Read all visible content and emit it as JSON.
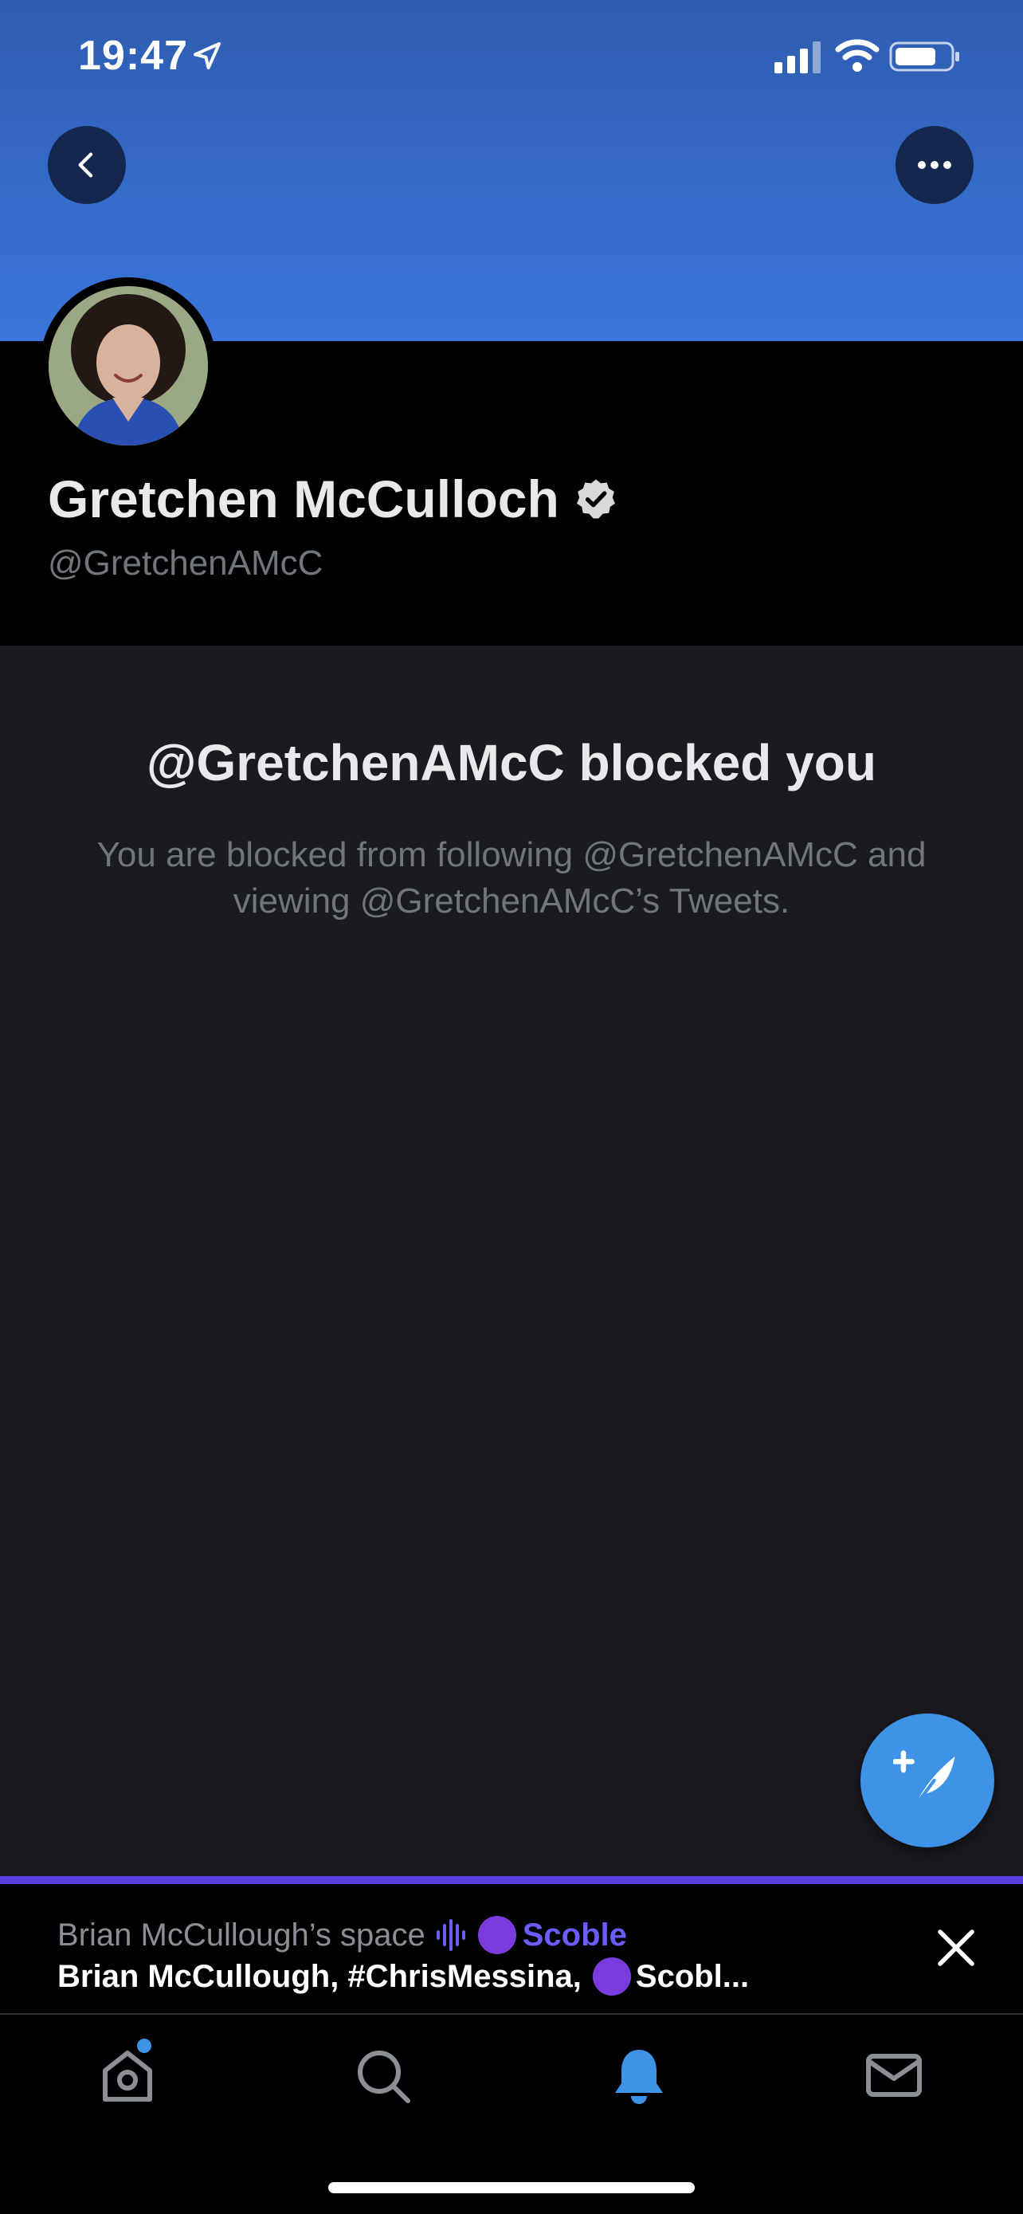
{
  "status_bar": {
    "time": "19:47"
  },
  "profile": {
    "display_name": "Gretchen McCulloch",
    "handle": "@GretchenAMcC",
    "verified": true
  },
  "blocked_notice": {
    "title": "@GretchenAMcC blocked you",
    "description": "You are blocked from following @GretchenAMcC and viewing @GretchenAMcC’s Tweets."
  },
  "space_bar": {
    "title": "Brian McCullough’s space",
    "host_label": "Scoble",
    "participants_prefix": "Brian McCullough, #ChrisMessina,",
    "participants_suffix": "Scobl..."
  },
  "colors": {
    "accent": "#3f93e6",
    "banner_top": "#2e5cb0",
    "banner_bottom": "#3a76dc",
    "space_purple": "#5b3fe0"
  },
  "icons": {
    "back": "chevron-left-icon",
    "more": "ellipsis-icon",
    "compose": "compose-feather-icon",
    "tabs": [
      "home-icon",
      "search-icon",
      "bell-icon",
      "mail-icon"
    ]
  }
}
